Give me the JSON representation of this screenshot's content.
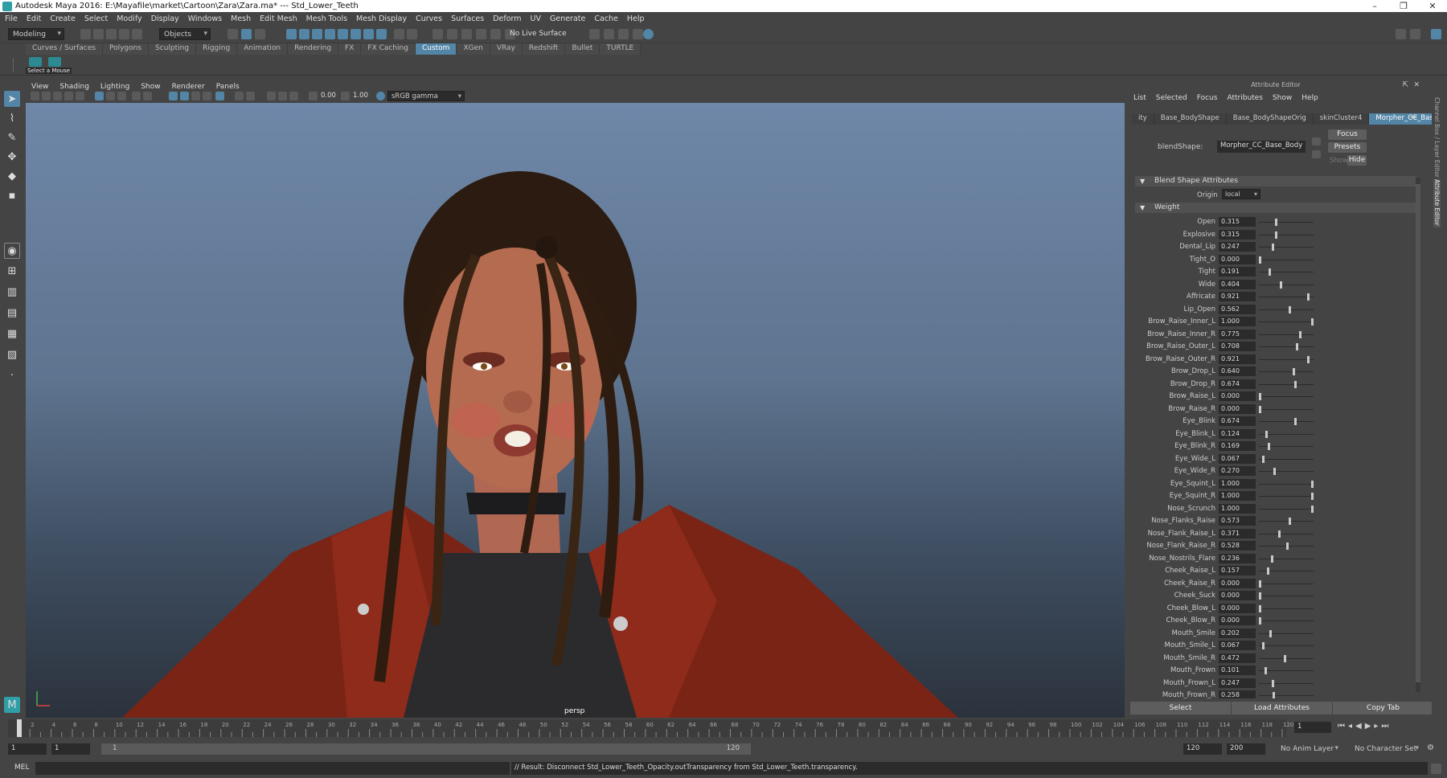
{
  "window": {
    "title": "Autodesk Maya 2016: E:\\Mayafile\\market\\Cartoon\\Zara\\Zara.ma*   ---   Std_Lower_Teeth"
  },
  "menus": [
    "File",
    "Edit",
    "Create",
    "Select",
    "Modify",
    "Display",
    "Windows",
    "Mesh",
    "Edit Mesh",
    "Mesh Tools",
    "Mesh Display",
    "Curves",
    "Surfaces",
    "Deform",
    "UV",
    "Generate",
    "Cache",
    "Help"
  ],
  "statusline": {
    "mode": "Modeling",
    "objects_label": "Objects",
    "live_surface": "No Live Surface"
  },
  "shelf": {
    "tabs": [
      "Curves / Surfaces",
      "Polygons",
      "Sculpting",
      "Rigging",
      "Animation",
      "Rendering",
      "FX",
      "FX Caching",
      "Custom",
      "XGen",
      "VRay",
      "Redshift",
      "Bullet",
      "TURTLE"
    ],
    "active_tab": "Custom",
    "shelf_button_label": "Select a Mouse"
  },
  "viewport": {
    "menus": [
      "View",
      "Shading",
      "Lighting",
      "Show",
      "Renderer",
      "Panels"
    ],
    "exposure": "0.00",
    "gamma": "1.00",
    "color_space": "sRGB gamma",
    "camera_label": "persp"
  },
  "attribute_editor": {
    "header": "Attribute Editor",
    "menus": [
      "List",
      "Selected",
      "Focus",
      "Attributes",
      "Show",
      "Help"
    ],
    "tabs": [
      "ity",
      "Base_BodyShape",
      "Base_BodyShapeOrig",
      "skinCluster4",
      "Morpher_CC_Base_Body"
    ],
    "active_tab": "Morpher_CC_Base_Body",
    "node_type_label": "blendShape:",
    "node_name": "Morpher_CC_Base_Body",
    "focus_button": "Focus",
    "presets_button": "Presets",
    "show_label": "Show",
    "hide_button": "Hide",
    "blend_section": "Blend Shape Attributes",
    "origin_label": "Origin",
    "origin_value": "local",
    "weight_section": "Weight",
    "weights": [
      {
        "name": "Open",
        "value": "0.315"
      },
      {
        "name": "Explosive",
        "value": "0.315"
      },
      {
        "name": "Dental_Lip",
        "value": "0.247"
      },
      {
        "name": "Tight_O",
        "value": "0.000"
      },
      {
        "name": "Tight",
        "value": "0.191"
      },
      {
        "name": "Wide",
        "value": "0.404"
      },
      {
        "name": "Affricate",
        "value": "0.921"
      },
      {
        "name": "Lip_Open",
        "value": "0.562"
      },
      {
        "name": "Brow_Raise_Inner_L",
        "value": "1.000"
      },
      {
        "name": "Brow_Raise_Inner_R",
        "value": "0.775"
      },
      {
        "name": "Brow_Raise_Outer_L",
        "value": "0.708"
      },
      {
        "name": "Brow_Raise_Outer_R",
        "value": "0.921"
      },
      {
        "name": "Brow_Drop_L",
        "value": "0.640"
      },
      {
        "name": "Brow_Drop_R",
        "value": "0.674"
      },
      {
        "name": "Brow_Raise_L",
        "value": "0.000"
      },
      {
        "name": "Brow_Raise_R",
        "value": "0.000"
      },
      {
        "name": "Eye_Blink",
        "value": "0.674"
      },
      {
        "name": "Eye_Blink_L",
        "value": "0.124"
      },
      {
        "name": "Eye_Blink_R",
        "value": "0.169"
      },
      {
        "name": "Eye_Wide_L",
        "value": "0.067"
      },
      {
        "name": "Eye_Wide_R",
        "value": "0.270"
      },
      {
        "name": "Eye_Squint_L",
        "value": "1.000"
      },
      {
        "name": "Eye_Squint_R",
        "value": "1.000"
      },
      {
        "name": "Nose_Scrunch",
        "value": "1.000"
      },
      {
        "name": "Nose_Flanks_Raise",
        "value": "0.573"
      },
      {
        "name": "Nose_Flank_Raise_L",
        "value": "0.371"
      },
      {
        "name": "Nose_Flank_Raise_R",
        "value": "0.528"
      },
      {
        "name": "Nose_Nostrils_Flare",
        "value": "0.236"
      },
      {
        "name": "Cheek_Raise_L",
        "value": "0.157"
      },
      {
        "name": "Cheek_Raise_R",
        "value": "0.000"
      },
      {
        "name": "Cheek_Suck",
        "value": "0.000"
      },
      {
        "name": "Cheek_Blow_L",
        "value": "0.000"
      },
      {
        "name": "Cheek_Blow_R",
        "value": "0.000"
      },
      {
        "name": "Mouth_Smile",
        "value": "0.202"
      },
      {
        "name": "Mouth_Smile_L",
        "value": "0.067"
      },
      {
        "name": "Mouth_Smile_R",
        "value": "0.472"
      },
      {
        "name": "Mouth_Frown",
        "value": "0.101"
      },
      {
        "name": "Mouth_Frown_L",
        "value": "0.247"
      },
      {
        "name": "Mouth_Frown_R",
        "value": "0.258"
      }
    ],
    "bottom_buttons": [
      "Select",
      "Load Attributes",
      "Copy Tab"
    ],
    "side_tabs": [
      "Channel Box / Layer Editor",
      "Attribute Editor"
    ]
  },
  "timeline": {
    "ticks": [
      "2",
      "4",
      "6",
      "8",
      "10",
      "12",
      "14",
      "16",
      "18",
      "20",
      "22",
      "24",
      "26",
      "28",
      "30",
      "32",
      "34",
      "36",
      "38",
      "40",
      "42",
      "44",
      "46",
      "48",
      "50",
      "52",
      "54",
      "56",
      "58",
      "60",
      "62",
      "64",
      "66",
      "68",
      "70",
      "72",
      "74",
      "76",
      "78",
      "80",
      "82",
      "84",
      "86",
      "88",
      "90",
      "92",
      "94",
      "96",
      "98",
      "100",
      "102",
      "104",
      "106",
      "108",
      "110",
      "112",
      "114",
      "116",
      "118",
      "120"
    ],
    "current_frame": "1",
    "start_frame": "1",
    "range_start": "1",
    "range_start_inner": "1",
    "range_end_inner": "120",
    "range_end": "120",
    "anim_end": "200",
    "anim_layer": "No Anim Layer",
    "character_set": "No Character Set"
  },
  "command_line": {
    "language": "MEL",
    "result": "// Result: Disconnect Std_Lower_Teeth_Opacity.outTransparency from Std_Lower_Teeth.transparency."
  },
  "colors": {
    "accent": "#5285a6",
    "panel": "#444444",
    "field": "#2b2b2b"
  }
}
